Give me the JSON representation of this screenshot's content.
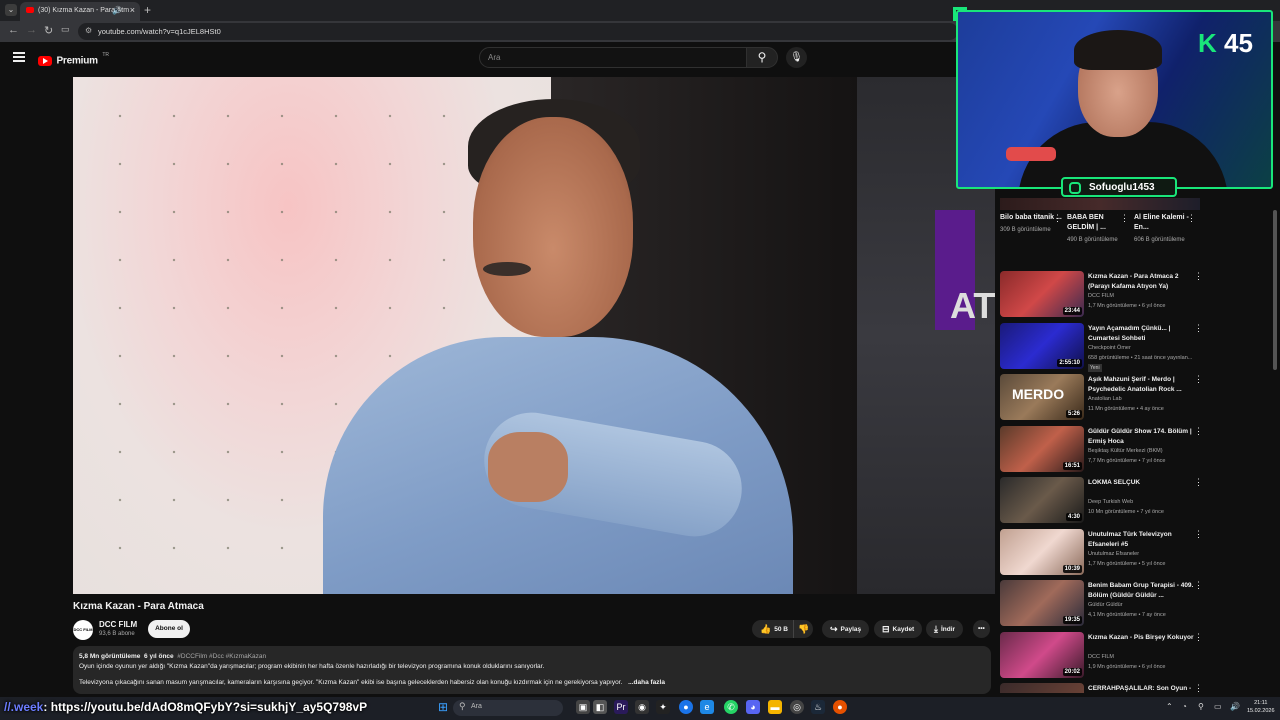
{
  "browser": {
    "tab_title": "(30) Kızma Kazan - Para Atm",
    "url": "youtube.com/watch?v=q1cJEL8HSt0"
  },
  "youtube": {
    "logo_text": "Premium",
    "logo_region": "TR",
    "search_placeholder": "Ara"
  },
  "video": {
    "title": "Kızma Kazan - Para Atmaca",
    "channel_name": "DCC FILM",
    "channel_avatar_text": "DCC FILM",
    "subscribers": "93,6 B abone",
    "subscribe_label": "Abone ol",
    "likes": "50 B",
    "share_label": "Paylaş",
    "save_label": "Kaydet",
    "download_label": "İndir",
    "more_label": "•••",
    "bg_screen_text": "AT"
  },
  "description": {
    "views": "5,8 Mn görüntüleme",
    "age": "6 yıl önce",
    "tags": "#DCCFilm #Dcc #KızmaKazan",
    "line1": "Oyun içinde oyunun yer aldığı \"Kızma Kazan\"da yarışmacılar; program ekibinin her hafta özenle hazırladığı bir televizyon programına konuk olduklarını sanıyorlar.",
    "line2": "Televizyona çıkacağını sanan masum yarışmacılar, kameraların karşısına geçiyor. \"Kızma Kazan\" ekibi ise başına geleceklerden habersiz olan konuğu kızdırmak için ne gerekiyorsa yapıyor.",
    "more": "...daha fazla"
  },
  "stream_overlay": {
    "cam_logo_letter": "K",
    "cam_logo_number": "45",
    "instagram_handle": "Sofuoglu1453",
    "bottom_link_prefix": "//.week",
    "bottom_link": ": https://youtu.be/dAdO8mQFybY?si=sukhjY_ay5Q798vP"
  },
  "shorts": [
    {
      "title": "Bilo baba titanik ...",
      "views": "309 B görüntüleme"
    },
    {
      "title": "BABA BEN GELDİM | ...",
      "views": "490 B görüntüleme"
    },
    {
      "title": "Al Eline Kalemi - En...",
      "views": "606 B görüntüleme"
    }
  ],
  "recommendations": [
    {
      "title": "Kızma Kazan - Para Atmaca 2 (Parayı Kafama Atıyon Ya)",
      "channel": "DCC FILM",
      "meta": "1,7 Mn görüntüleme • 6 yıl önce",
      "duration": "23:44",
      "thumb": "linear-gradient(135deg,#8a2a2a,#d04848 50%,#3a2a50)"
    },
    {
      "title": "Yayın Açamadım Çünkü... | Cumartesi Sohbeti",
      "channel": "Checkpoint Ömer",
      "meta": "658 görüntüleme • 21 saat önce yayınlan...",
      "duration": "2:55:10",
      "badge": "Yeni",
      "thumb": "linear-gradient(135deg,#1a1a7a,#2b2bd0 50%,#10104a)"
    },
    {
      "title": "Aşık Mahzuni Şerif - Merdo | Psychedelic Anatolian Rock ...",
      "channel": "Anatolian Lab",
      "meta": "11 Mn görüntüleme • 4 ay önce",
      "duration": "5:26",
      "thumb_text": "MERDO",
      "thumb": "linear-gradient(135deg,#5a4a3a,#9a7a5a 50%,#3a2a1a)"
    },
    {
      "title": "Güldür Güldür Show 174. Bölüm | Ermiş Hoca",
      "channel": "Beşiktaş Kültür Merkezi (BKM)",
      "meta": "7,7 Mn görüntüleme • 7 yıl önce",
      "duration": "16:51",
      "thumb": "linear-gradient(135deg,#5a3a2a,#c0604a 50%,#2a1a1a)"
    },
    {
      "title": "LOKMA SELÇUK",
      "channel": "Deep Turkish Web",
      "meta": "10 Mn görüntüleme • 7 yıl önce",
      "duration": "4:30",
      "thumb": "linear-gradient(135deg,#2a2a2a,#6a5a4a 50%,#1a1a1a)"
    },
    {
      "title": "Unutulmaz Türk Televizyon Efsaneleri #5",
      "channel": "Unutulmaz Efsaneler",
      "meta": "1,7 Mn görüntüleme • 5 yıl önce",
      "duration": "10:39",
      "thumb": "linear-gradient(135deg,#c0a090,#f0d8d0 50%,#8a6a5a)"
    },
    {
      "title": "Benim Babam Grup Terapisi - 409. Bölüm (Güldür Güldür ...",
      "channel": "Güldür Güldür",
      "meta": "4,1 Mn görüntüleme • 7 ay önce",
      "duration": "19:35",
      "thumb": "linear-gradient(135deg,#4a3a3a,#a06a5a 50%,#2a2a3a)"
    },
    {
      "title": "Kızma Kazan - Pis Birşey Kokuyor",
      "channel": "DCC FILM",
      "meta": "1,9 Mn görüntüleme • 6 yıl önce",
      "duration": "20:02",
      "thumb": "linear-gradient(135deg,#6a2a4a,#d04a8a 50%,#3a1a2a)"
    },
    {
      "title": "CERRAHPAŞALILAR: Son Oyun -",
      "channel": "",
      "meta": "",
      "duration": "",
      "thumb": "linear-gradient(135deg,#3a2a2a,#7a4a3a)"
    }
  ],
  "taskbar": {
    "search": "Ara",
    "time": "21:11",
    "date": "15.02.2026"
  },
  "colors": {
    "accent_green": "#19e67a",
    "youtube_red": "#ff0000"
  }
}
